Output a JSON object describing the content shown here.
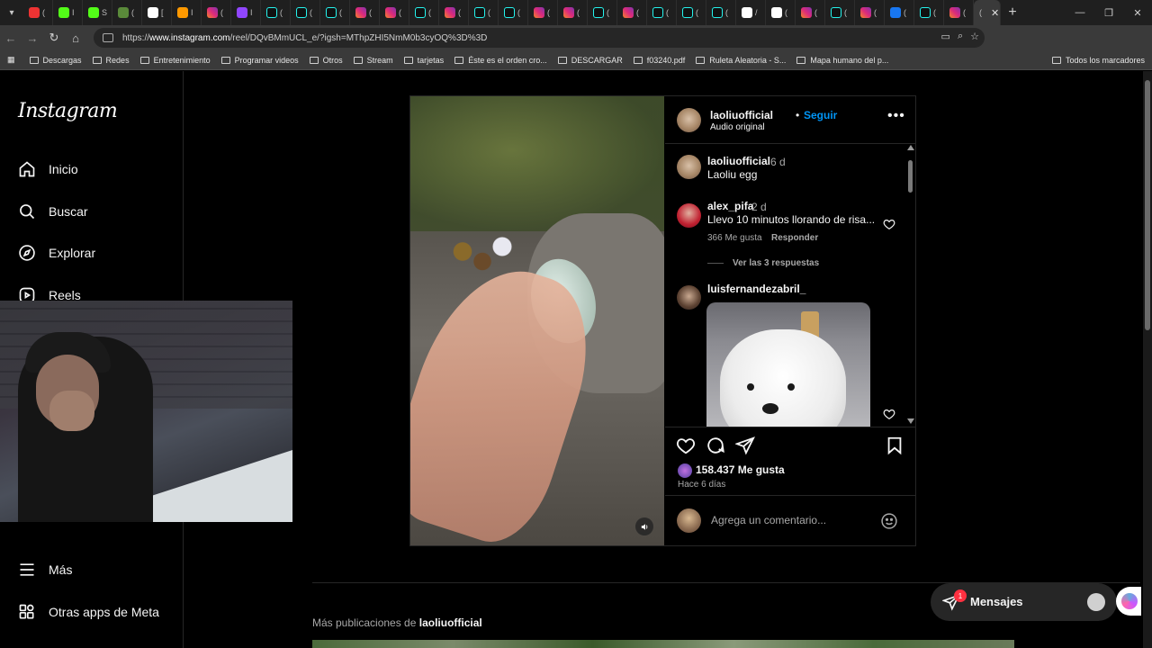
{
  "browser": {
    "tabs": [
      {
        "fav": "fav-yt",
        "title": "("
      },
      {
        "fav": "fav-kick",
        "title": "I"
      },
      {
        "fav": "fav-kick",
        "title": "S"
      },
      {
        "fav": "fav-gr",
        "title": "("
      },
      {
        "fav": "fav-g",
        "title": "["
      },
      {
        "fav": "fav-o",
        "title": "I"
      },
      {
        "fav": "fav-ig",
        "title": "("
      },
      {
        "fav": "fav-tw",
        "title": "I"
      },
      {
        "fav": "fav-tt",
        "title": "("
      },
      {
        "fav": "fav-tt",
        "title": "("
      },
      {
        "fav": "fav-tt",
        "title": "("
      },
      {
        "fav": "fav-ig",
        "title": "("
      },
      {
        "fav": "fav-ig",
        "title": "("
      },
      {
        "fav": "fav-tt",
        "title": "("
      },
      {
        "fav": "fav-ig",
        "title": "("
      },
      {
        "fav": "fav-tt",
        "title": "("
      },
      {
        "fav": "fav-tt",
        "title": "("
      },
      {
        "fav": "fav-ig",
        "title": "("
      },
      {
        "fav": "fav-ig",
        "title": "("
      },
      {
        "fav": "fav-tt",
        "title": "("
      },
      {
        "fav": "fav-ig",
        "title": "("
      },
      {
        "fav": "fav-tt",
        "title": "("
      },
      {
        "fav": "fav-tt",
        "title": "("
      },
      {
        "fav": "fav-tt",
        "title": "("
      },
      {
        "fav": "fav-g",
        "title": "/"
      },
      {
        "fav": "fav-g",
        "title": "("
      },
      {
        "fav": "fav-ig",
        "title": "("
      },
      {
        "fav": "fav-tt",
        "title": "("
      },
      {
        "fav": "fav-ig",
        "title": "("
      },
      {
        "fav": "fav-fb",
        "title": "("
      },
      {
        "fav": "fav-tt",
        "title": "("
      },
      {
        "fav": "fav-ig",
        "title": "("
      }
    ],
    "url_prefix": "https://",
    "url_host": "www.instagram.com",
    "url_path": "/reel/DQvBMmUCL_e/?igsh=MThpZHI5NmM0b3cyOQ%3D%3D",
    "bookmarks": [
      "Descargas",
      "Redes",
      "Entretenimiento",
      "Programar videos",
      "Otros",
      "Stream",
      "tarjetas",
      "Éste es el orden cro...",
      "DESCARGAR",
      "f03240.pdf",
      "Ruleta Aleatoria - S...",
      "Mapa humano del p..."
    ],
    "bookmarks_all": "Todos los marcadores"
  },
  "instagram": {
    "logo": "Instagram",
    "nav": [
      {
        "label": "Inicio",
        "icon": "home-icon"
      },
      {
        "label": "Buscar",
        "icon": "search-icon"
      },
      {
        "label": "Explorar",
        "icon": "compass-icon"
      },
      {
        "label": "Reels",
        "icon": "reels-icon"
      }
    ],
    "nav_bottom": [
      {
        "label": "Más",
        "icon": "menu-icon"
      },
      {
        "label": "Otras apps de Meta",
        "icon": "meta-apps-icon"
      }
    ],
    "post": {
      "author": "laoliuofficial",
      "follow": "Seguir",
      "separator": "•",
      "audio": "Audio original",
      "caption_user": "laoliuofficial",
      "caption_age": "6 d",
      "caption": "Laoliu egg",
      "comments": [
        {
          "user": "alex_pifa",
          "age": "2 d",
          "text": "Llevo 10 minutos llorando de risa...",
          "likes": "366 Me gusta",
          "reply": "Responder",
          "replies": "Ver las 3 respuestas"
        },
        {
          "user": "luisfernandezabril_"
        }
      ],
      "likes": "158.437 Me gusta",
      "ago": "Hace 6 días",
      "add_comment_placeholder": "Agrega un comentario..."
    },
    "more_prefix": "Más publicaciones de",
    "more_user": "laoliuofficial",
    "messages": {
      "label": "Mensajes",
      "badge": "1"
    }
  }
}
